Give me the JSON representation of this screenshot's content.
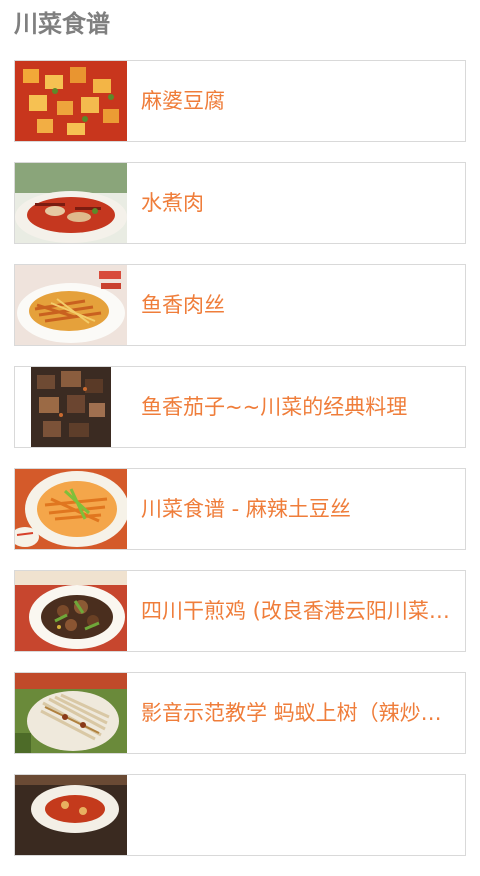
{
  "header": {
    "title": "川菜食谱"
  },
  "recipes": [
    {
      "title": "麻婆豆腐"
    },
    {
      "title": "水煮肉"
    },
    {
      "title": "鱼香肉丝"
    },
    {
      "title": "鱼香茄子~~川菜的经典料理"
    },
    {
      "title": "川菜食谱 - 麻辣土豆丝"
    },
    {
      "title": "四川干煎鸡 (改良香港云阳川菜…"
    },
    {
      "title": "影音示范教学 蚂蚁上树（辣炒…"
    },
    {
      "title": ""
    }
  ],
  "colors": {
    "title_text": "#ef7d3a",
    "header_text": "#7f7f7f",
    "card_border": "#d9d9d9"
  }
}
